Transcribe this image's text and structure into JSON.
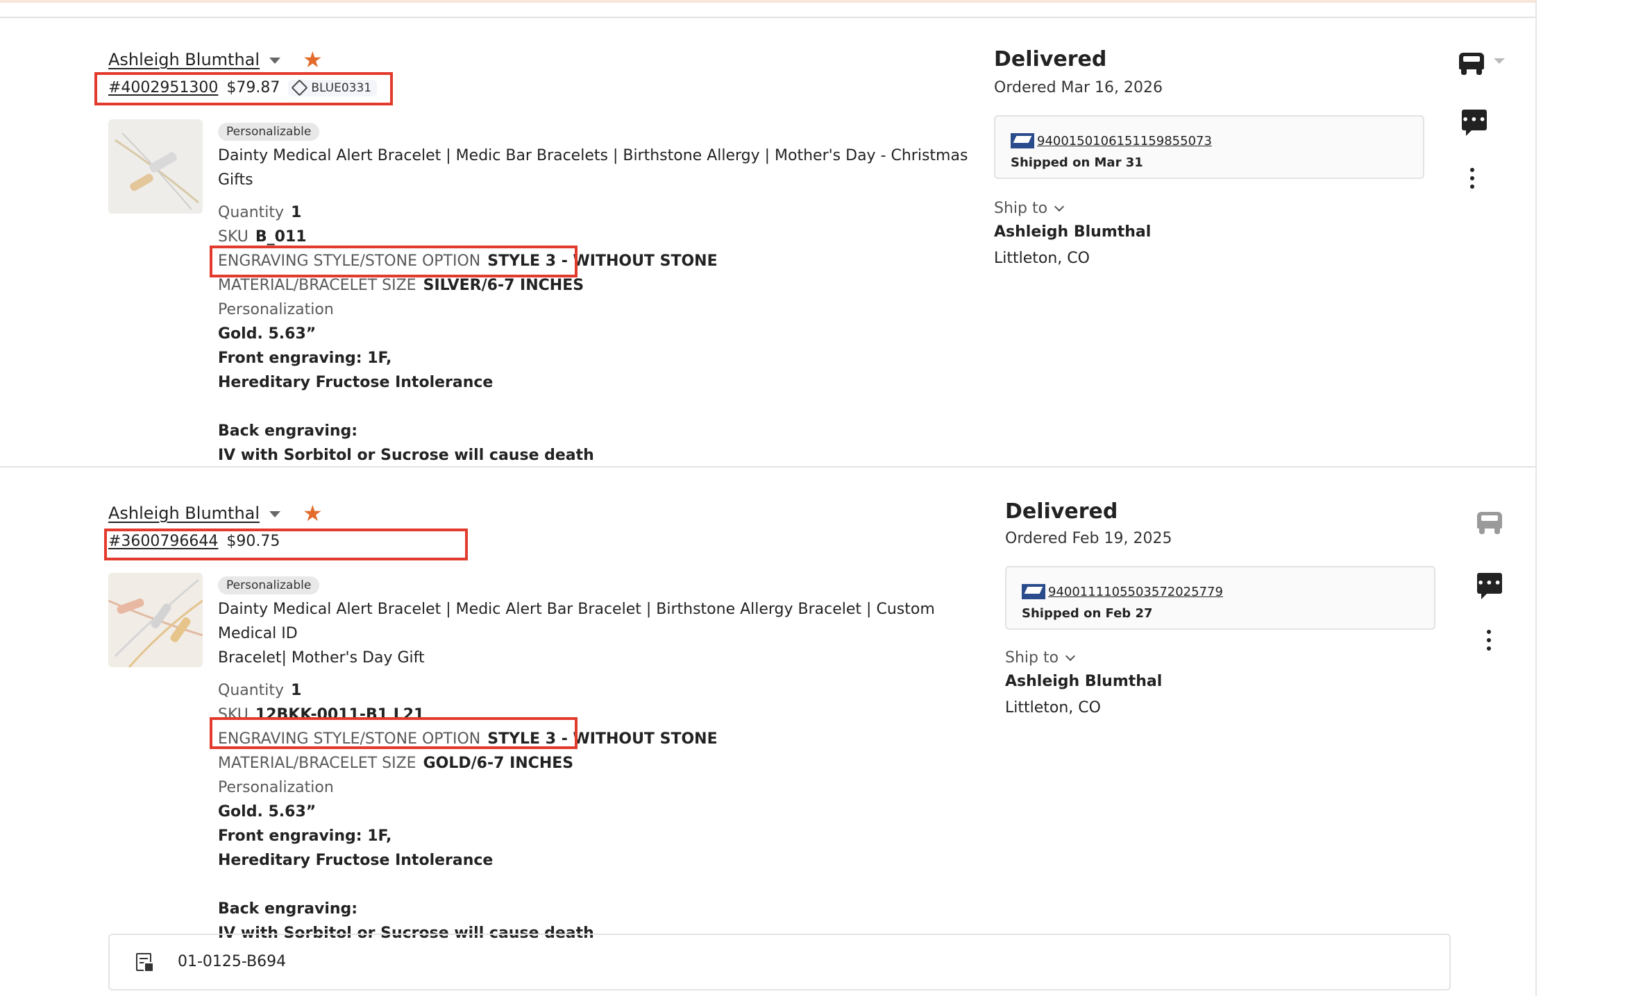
{
  "orders": [
    {
      "buyer": "Ashleigh Blumthal",
      "order_number": "#4002951300",
      "price": "$79.87",
      "coupon": "BLUE0331",
      "badge": "Personalizable",
      "title": "Dainty Medical Alert Bracelet | Medic Bar Bracelets | Birthstone Allergy | Mother's Day - Christmas Gifts",
      "quantity_label": "Quantity",
      "quantity": "1",
      "sku_label": "SKU",
      "sku": "B_011",
      "engraving_label": "ENGRAVING STYLE/STONE OPTION",
      "engraving": "STYLE 3 - WITHOUT STONE",
      "material_label": "MATERIAL/BRACELET SIZE",
      "material": "SILVER/6-7 INCHES",
      "personalization_label": "Personalization",
      "personalization": [
        "Gold. 5.63”",
        "Front engraving: 1F,",
        "Hereditary Fructose Intolerance",
        "",
        "Back engraving:",
        "IV with Sorbitol or Sucrose will cause death"
      ],
      "status": "Delivered",
      "ordered": "Ordered Mar 16, 2026",
      "tracking": "9400150106151159855073",
      "shipped": "Shipped on Mar 31",
      "ship_to_label": "Ship to",
      "ship_name": "Ashleigh Blumthal",
      "ship_city": "Littleton, CO"
    },
    {
      "buyer": "Ashleigh Blumthal",
      "order_number": "#3600796644",
      "price": "$90.75",
      "badge": "Personalizable",
      "title_lines": [
        "Dainty Medical Alert Bracelet | Medic Alert Bar Bracelet | Birthstone Allergy Bracelet | Custom Medical ID",
        "Bracelet| Mother's Day Gift"
      ],
      "quantity_label": "Quantity",
      "quantity": "1",
      "sku_label": "SKU",
      "sku": "12BKK-0011-B1 L21",
      "engraving_label": "ENGRAVING STYLE/STONE OPTION",
      "engraving": "STYLE 3 - WITHOUT STONE",
      "material_label": "MATERIAL/BRACELET SIZE",
      "material": "GOLD/6-7 INCHES",
      "personalization_label": "Personalization",
      "personalization": [
        "Gold. 5.63”",
        "Front engraving: 1F,",
        "Hereditary Fructose Intolerance",
        "",
        "Back engraving:",
        "IV with Sorbitol or Sucrose will cause death"
      ],
      "status": "Delivered",
      "ordered": "Ordered Feb 19, 2025",
      "tracking": "9400111105503572025779",
      "shipped": "Shipped on Feb 27",
      "ship_to_label": "Ship to",
      "ship_name": "Ashleigh Blumthal",
      "ship_city": "Littleton, CO",
      "note": "01-0125-B694"
    }
  ],
  "colors": {
    "highlight_box": "#e23b2e",
    "star": "#e36b2c",
    "usps_blue": "#2b4c8c"
  },
  "icons": {
    "truck_active": "truck-icon",
    "truck_inactive": "truck-icon",
    "message": "message-icon",
    "more": "more-vertical-icon",
    "coupon": "tag-icon",
    "note": "note-lock-icon"
  }
}
